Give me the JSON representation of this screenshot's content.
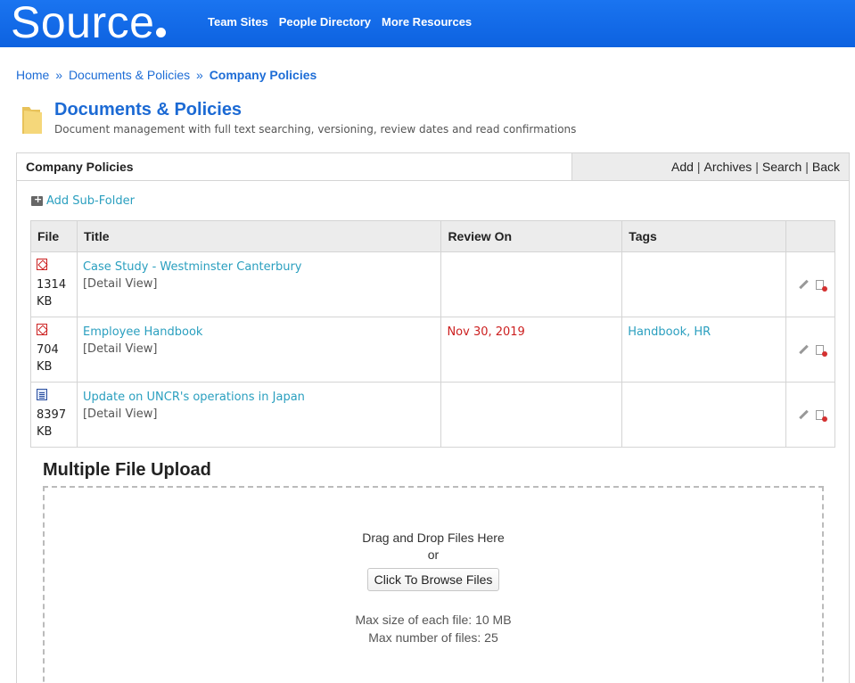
{
  "header": {
    "logo": "Source",
    "nav": [
      "Team Sites",
      "People Directory",
      "More Resources"
    ]
  },
  "breadcrumb": {
    "home": "Home",
    "sep": "»",
    "section": "Documents & Policies",
    "current": "Company Policies"
  },
  "module": {
    "title": "Documents & Policies",
    "description": "Document management with full text searching, versioning, review dates and read confirmations"
  },
  "panel": {
    "title": "Company Policies",
    "actions": [
      "Add",
      "Archives",
      "Search",
      "Back"
    ],
    "add_subfolder": "Add Sub-Folder"
  },
  "table": {
    "headers": [
      "File",
      "Title",
      "Review On",
      "Tags",
      ""
    ],
    "rows": [
      {
        "icon": "pdf-icon",
        "size_num": "1314",
        "size_unit": "KB",
        "title": "Case Study - Westminster Canterbury",
        "detail": "[Detail View]",
        "review_on": "",
        "tags": ""
      },
      {
        "icon": "pdf-icon",
        "size_num": "704",
        "size_unit": "KB",
        "title": "Employee Handbook",
        "detail": "[Detail View]",
        "review_on": "Nov 30, 2019",
        "tags": "Handbook, HR"
      },
      {
        "icon": "word-doc-icon",
        "size_num": "8397",
        "size_unit": "KB",
        "title": "Update on UNCR's operations in Japan",
        "detail": "[Detail View]",
        "review_on": "",
        "tags": ""
      }
    ]
  },
  "upload": {
    "title": "Multiple File Upload",
    "drag_text": "Drag and Drop Files Here",
    "or_text": "or",
    "browse_label": "Click To Browse Files",
    "max_size": "Max size of each file: 10 MB",
    "max_files": "Max number of files: 25"
  },
  "colors": {
    "header_blue": "#0d62e0",
    "link_blue": "#1e6dd6",
    "link_teal": "#2a9fbf",
    "review_red": "#cc1f1f"
  }
}
